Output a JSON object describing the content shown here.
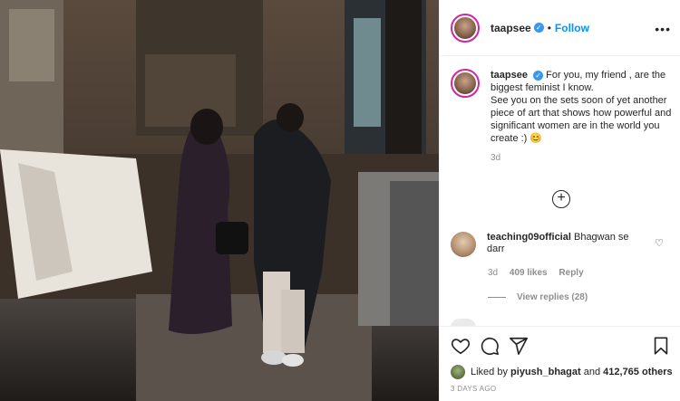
{
  "post": {
    "username": "taapsee",
    "verified_mark": "✓",
    "dot": "•",
    "follow_label": "Follow",
    "more_label": "•••"
  },
  "caption": {
    "username": "taapsee",
    "text_1": "For you, my friend , are the biggest feminist I know.",
    "text_2": "See you on the sets soon of yet another piece of art that shows how powerful and significant women are in the world you create :) 😊",
    "time": "3d"
  },
  "load_more": {
    "icon": "+"
  },
  "comment": {
    "username": "teaching09official",
    "text": "Bhagwan se darr",
    "heart": "♡",
    "time": "3d",
    "likes": "409 likes",
    "reply_label": "Reply",
    "view_replies": "View replies (28)"
  },
  "actions": {
    "liked_prefix": "Liked by",
    "liked_user": "piyush_bhagat",
    "liked_and": "and",
    "liked_count": "412,765 others",
    "date": "3 DAYS AGO"
  },
  "colors": {
    "link": "#0095f6",
    "verified": "#3897f0",
    "muted": "#8e8e8e",
    "text": "#262626"
  },
  "icons": [
    "heart-icon",
    "comment-icon",
    "share-icon",
    "bookmark-icon",
    "plus-circle-icon",
    "more-icon"
  ]
}
